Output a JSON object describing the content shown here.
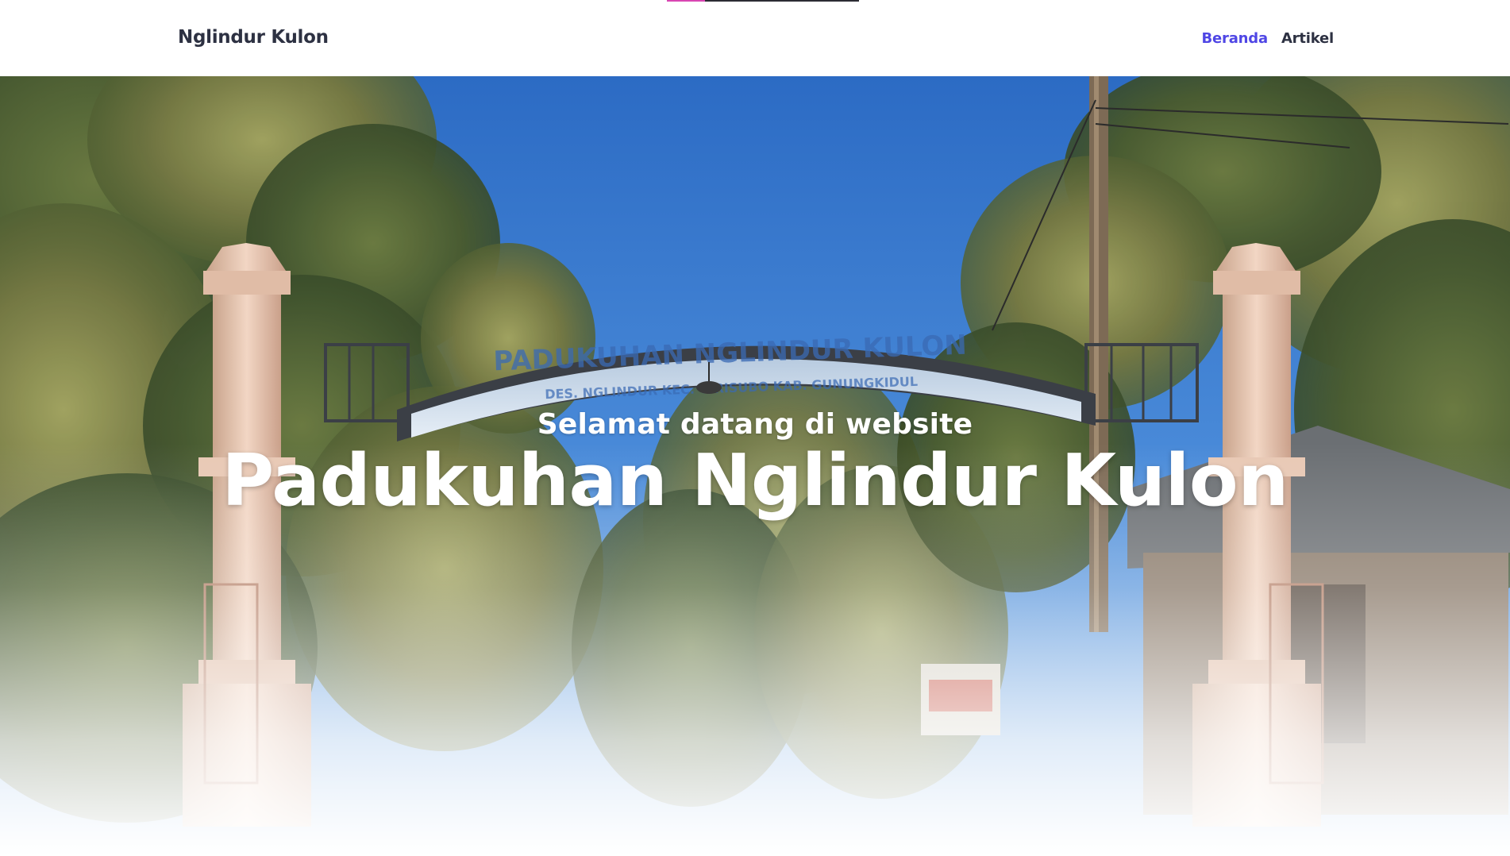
{
  "navbar": {
    "brand": "Nglindur Kulon",
    "links": [
      {
        "label": "Beranda",
        "active": true
      },
      {
        "label": "Artikel",
        "active": false
      }
    ]
  },
  "hero": {
    "subtitle": "Selamat datang di website",
    "title": "Padukuhan Nglindur Kulon",
    "image": {
      "sign_line1": "PADUKUHAN NGLINDUR KULON",
      "sign_line2": "DES. NGLINDUR KEC. GIRISUBO KAB. GUNUNGKIDUL"
    }
  },
  "colors": {
    "accent": "#4f46e5",
    "text_dark": "#2d3142",
    "progress": "#d946b2",
    "sky": "#3f7fd0"
  }
}
